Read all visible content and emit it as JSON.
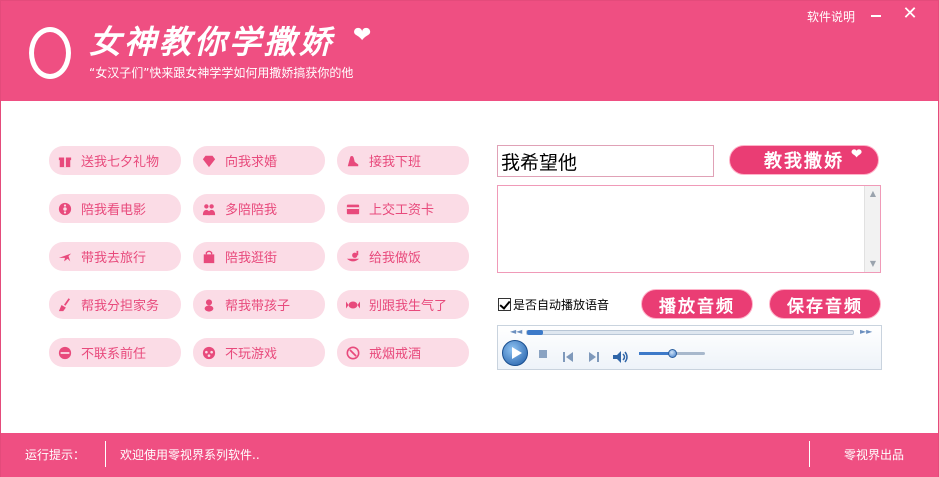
{
  "header": {
    "title": "女神教你学撒娇",
    "subtitle": "“女汉子们”快来跟女神学学如何用撒娇搞获你的他",
    "help_link": "软件说明",
    "close_glyph": "✕"
  },
  "presets": [
    {
      "label": "送我七夕礼物",
      "icon": "gift-icon"
    },
    {
      "label": "向我求婚",
      "icon": "diamond-ring-icon"
    },
    {
      "label": "接我下班",
      "icon": "high-heel-icon"
    },
    {
      "label": "陪我看电影",
      "icon": "film-reel-icon"
    },
    {
      "label": "多陪陪我",
      "icon": "couple-icon"
    },
    {
      "label": "上交工资卡",
      "icon": "wallet-icon"
    },
    {
      "label": "带我去旅行",
      "icon": "airplane-icon"
    },
    {
      "label": "陪我逛街",
      "icon": "shopping-bag-icon"
    },
    {
      "label": "给我做饭",
      "icon": "cooking-icon"
    },
    {
      "label": "帮我分担家务",
      "icon": "broom-icon"
    },
    {
      "label": "帮我带孩子",
      "icon": "baby-icon"
    },
    {
      "label": "别跟我生气了",
      "icon": "candy-icon"
    },
    {
      "label": "不联系前任",
      "icon": "no-entry-icon"
    },
    {
      "label": "不玩游戏",
      "icon": "game-icon"
    },
    {
      "label": "戒烟戒酒",
      "icon": "no-smoking-icon"
    }
  ],
  "phrase_input": {
    "value": "我希望他"
  },
  "teach_button": "教我撒娇",
  "output_text": "",
  "autoplay": {
    "label": "是否自动播放语音",
    "checked": true
  },
  "play_button": "播放音频",
  "save_button": "保存音频",
  "player": {
    "volume": 0.5,
    "progress": 0.0
  },
  "status": {
    "label": "运行提示：",
    "message": "欢迎使用零视界系列软件..",
    "brand": "零视界出品"
  },
  "colors": {
    "accent": "#ef4f82",
    "pill_bg": "#fbdce6",
    "pill_text": "#e84a7c",
    "button": "#ea3d74"
  }
}
